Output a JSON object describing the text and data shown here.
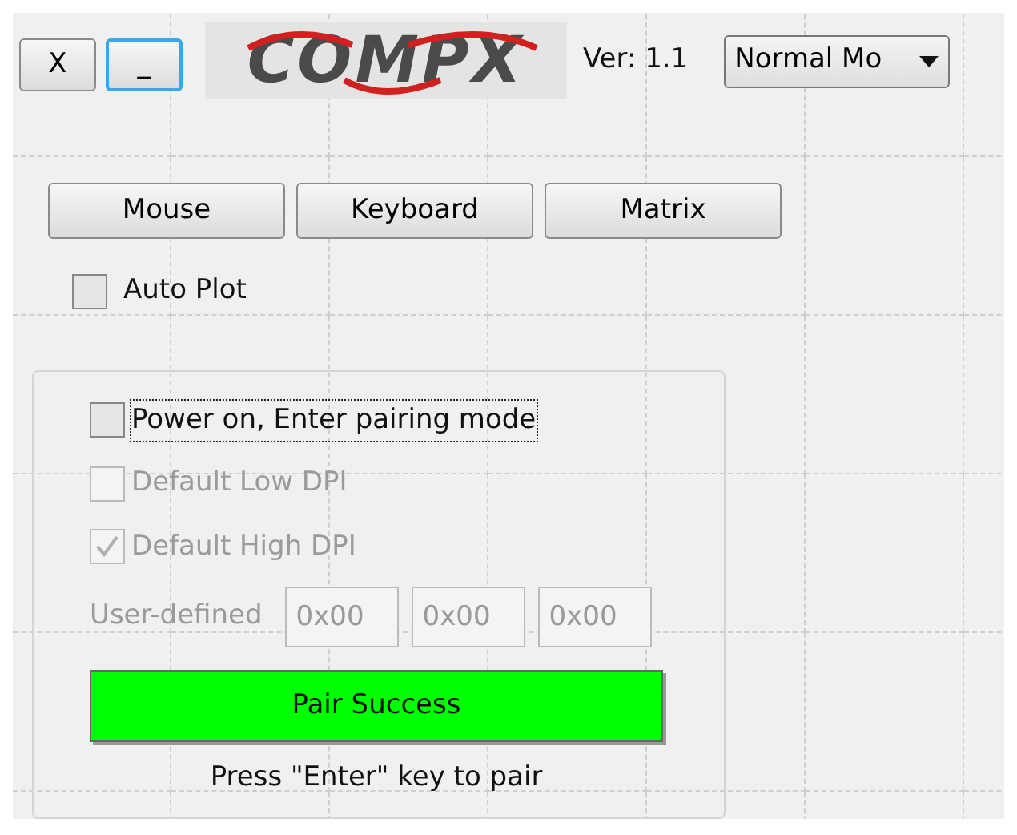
{
  "window_buttons": [
    {
      "label": "X",
      "focused": false
    },
    {
      "label": "_",
      "focused": true
    }
  ],
  "logo": {
    "text": "COMPX"
  },
  "version": "Ver: 1.1",
  "mode_dropdown": {
    "value": "Normal Mo"
  },
  "device_buttons": [
    "Mouse",
    "Keyboard",
    "Matrix"
  ],
  "auto_plot": {
    "label": "Auto Plot",
    "checked": false
  },
  "options": [
    {
      "label": "Power on, Enter pairing mode",
      "checked": false,
      "disabled": false,
      "focused": true
    },
    {
      "label": "Default Low DPI",
      "checked": false,
      "disabled": true,
      "focused": false
    },
    {
      "label": "Default High DPI",
      "checked": true,
      "disabled": true,
      "focused": false
    }
  ],
  "user_defined": {
    "label": "User-defined",
    "disabled": true,
    "values": [
      "0x00",
      "0x00",
      "0x00"
    ]
  },
  "status_bar": {
    "text": "Pair Success"
  },
  "hint": "Press \"Enter\" key to pair"
}
